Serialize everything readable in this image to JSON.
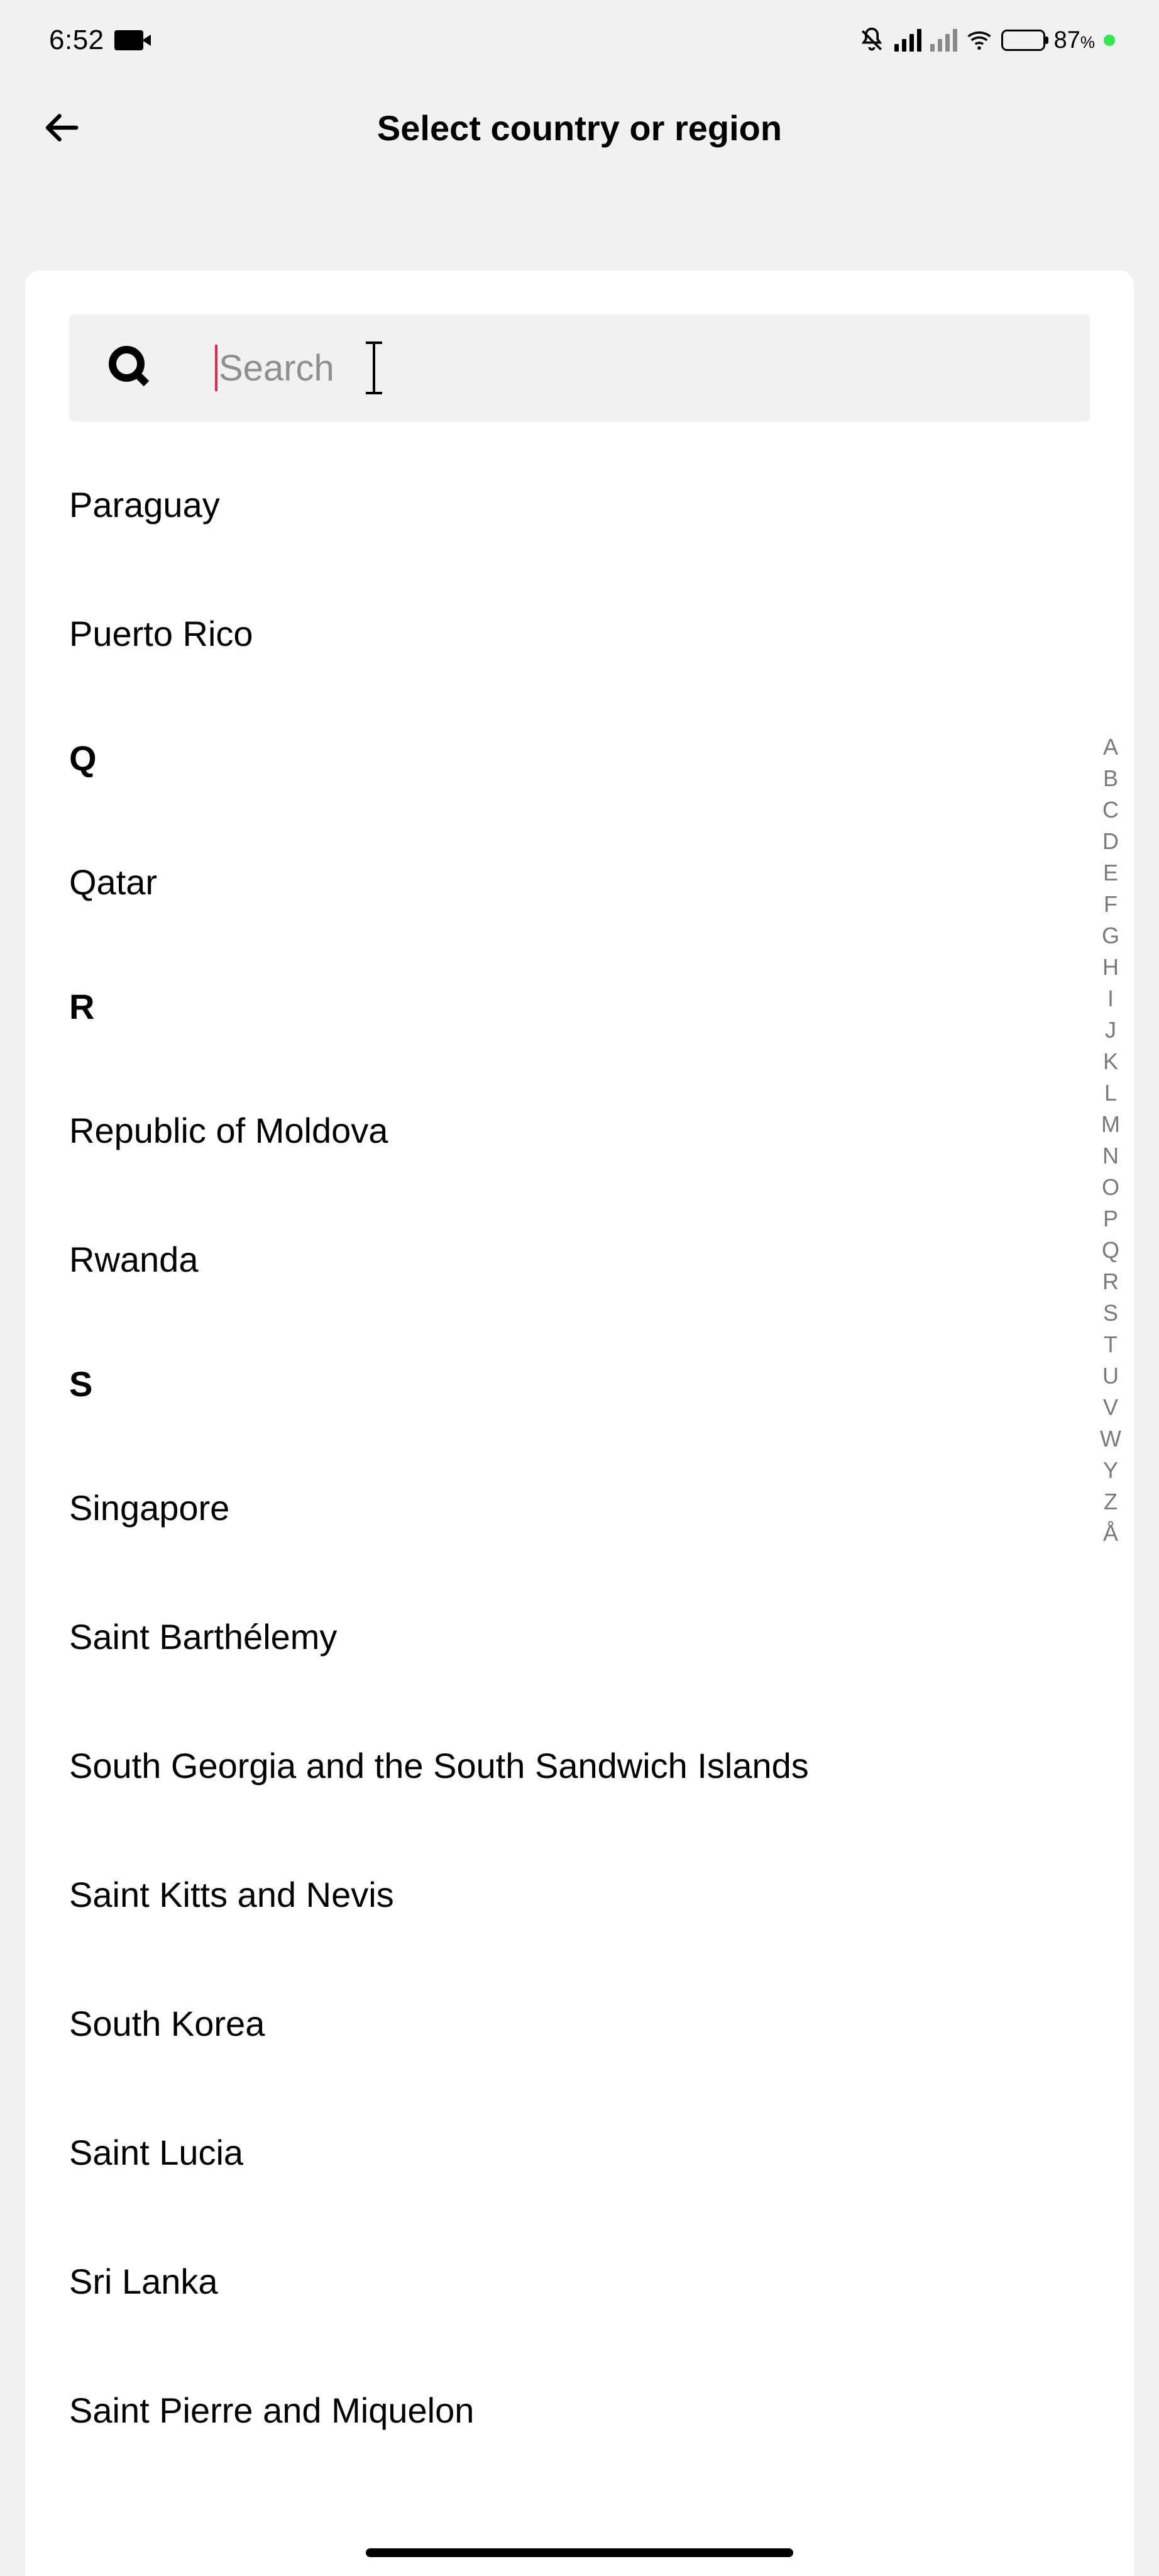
{
  "status": {
    "time": "6:52",
    "battery_pct": "87",
    "battery_pct_suffix": "%"
  },
  "header": {
    "title": "Select country or region"
  },
  "search": {
    "placeholder": "Search",
    "value": ""
  },
  "items_before_sections": [
    "Paraguay",
    "Puerto Rico"
  ],
  "sections": [
    {
      "letter": "Q",
      "items": [
        "Qatar"
      ]
    },
    {
      "letter": "R",
      "items": [
        "Republic of Moldova",
        "Rwanda"
      ]
    },
    {
      "letter": "S",
      "items": [
        "Singapore",
        "Saint Barthélemy",
        "South Georgia and the South Sandwich Islands",
        "Saint Kitts and Nevis",
        "South Korea",
        "Saint Lucia",
        "Sri Lanka",
        "Saint Pierre and Miquelon"
      ]
    }
  ],
  "index_rail": [
    "A",
    "B",
    "C",
    "D",
    "E",
    "F",
    "G",
    "H",
    "I",
    "J",
    "K",
    "L",
    "M",
    "N",
    "O",
    "P",
    "Q",
    "R",
    "S",
    "T",
    "U",
    "V",
    "W",
    "Y",
    "Z",
    "Å"
  ]
}
